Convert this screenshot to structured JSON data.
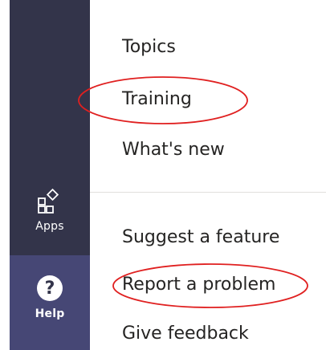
{
  "sidebar": {
    "apps_label": "Apps",
    "help_label": "Help",
    "colors": {
      "rail": "#33344a",
      "active": "#464775"
    }
  },
  "help_menu": {
    "sections": [
      {
        "items": [
          "Topics",
          "Training",
          "What's new"
        ]
      },
      {
        "items": [
          "Suggest a feature",
          "Report a problem",
          "Give feedback"
        ]
      }
    ]
  },
  "annotations": {
    "color": "#e02020",
    "circled_items": [
      "Training",
      "Report a problem"
    ]
  }
}
